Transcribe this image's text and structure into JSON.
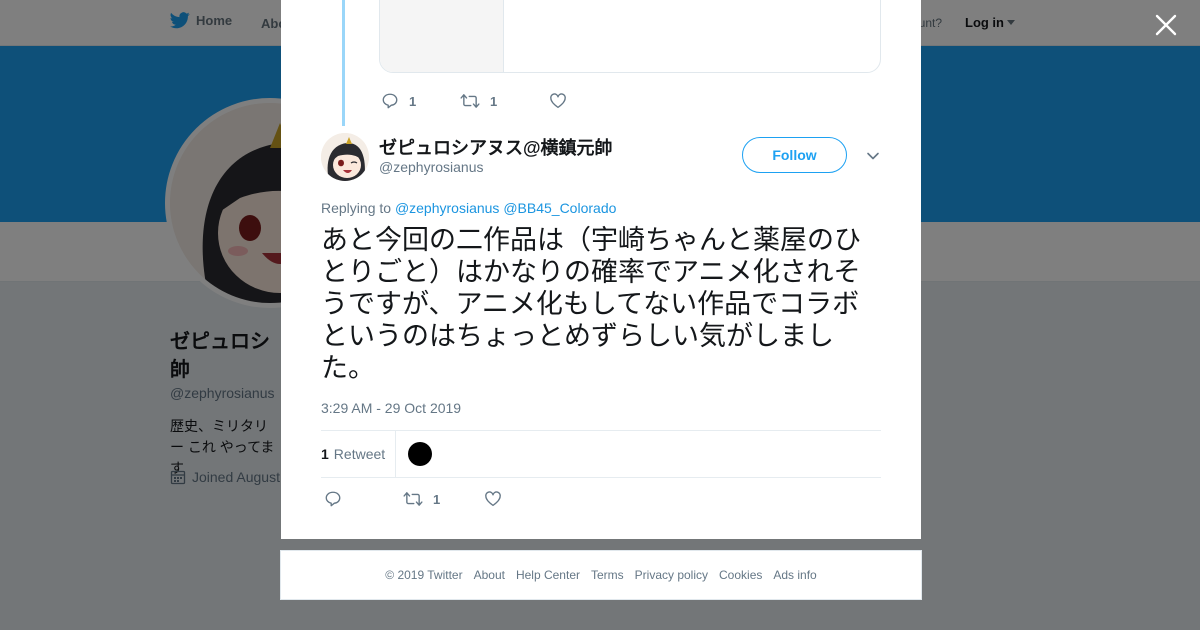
{
  "nav": {
    "home_label": "Home",
    "about_label": "Abo",
    "account_prompt": "ccount?",
    "login_label": "Log in"
  },
  "profile": {
    "name": "ゼピュロシ 帥",
    "handle": "@zephyrosianus",
    "bio": "歴史、ミリタリー これ やってます",
    "joined": "Joined August"
  },
  "previous_tweet": {
    "reply_count": "1",
    "retweet_count": "1"
  },
  "tweet": {
    "display_name": "ゼピュロシアヌス@横鎮元帥",
    "handle": "@zephyrosianus",
    "follow_label": "Follow",
    "replying_prefix": "Replying to",
    "mentions": [
      "@zephyrosianus",
      "@BB45_Colorado"
    ],
    "text": "あと今回の二作品は（宇崎ちゃんと薬屋のひとりごと）はかなりの確率でアニメ化されそうですが、アニメ化もしてない作品でコラボというのはちょっとめずらしい気がしました。",
    "timestamp": "3:29 AM - 29 Oct 2019",
    "retweet_stat_count": "1",
    "retweet_stat_label": "Retweet",
    "retweet_count": "1"
  },
  "footer": {
    "copyright": "© 2019 Twitter",
    "links": [
      "About",
      "Help Center",
      "Terms",
      "Privacy policy",
      "Cookies",
      "Ads info"
    ]
  },
  "colors": {
    "brand_blue": "#1da1f2",
    "link_blue": "#1b95e0",
    "thread_line": "#9ad6f9",
    "muted_text": "#657786"
  },
  "icons": {
    "logo": "twitter-bird-icon",
    "close": "close-icon",
    "reply": "reply-icon",
    "retweet": "retweet-icon",
    "like": "heart-icon",
    "more": "chevron-down-icon",
    "joined": "calendar-icon"
  }
}
